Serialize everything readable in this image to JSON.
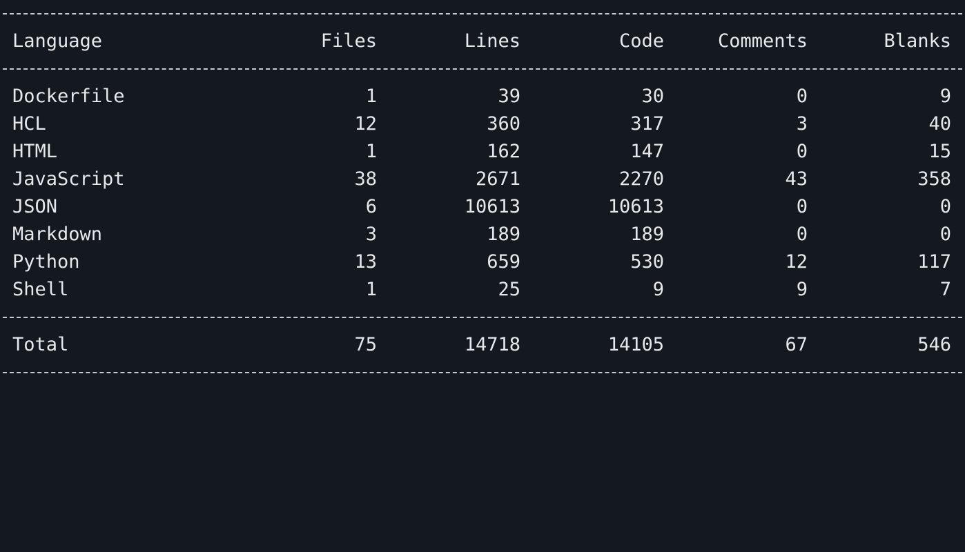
{
  "header": {
    "language": "Language",
    "files": "Files",
    "lines": "Lines",
    "code": "Code",
    "comments": "Comments",
    "blanks": "Blanks"
  },
  "rows": [
    {
      "language": "Dockerfile",
      "files": "1",
      "lines": "39",
      "code": "30",
      "comments": "0",
      "blanks": "9"
    },
    {
      "language": "HCL",
      "files": "12",
      "lines": "360",
      "code": "317",
      "comments": "3",
      "blanks": "40"
    },
    {
      "language": "HTML",
      "files": "1",
      "lines": "162",
      "code": "147",
      "comments": "0",
      "blanks": "15"
    },
    {
      "language": "JavaScript",
      "files": "38",
      "lines": "2671",
      "code": "2270",
      "comments": "43",
      "blanks": "358"
    },
    {
      "language": "JSON",
      "files": "6",
      "lines": "10613",
      "code": "10613",
      "comments": "0",
      "blanks": "0"
    },
    {
      "language": "Markdown",
      "files": "3",
      "lines": "189",
      "code": "189",
      "comments": "0",
      "blanks": "0"
    },
    {
      "language": "Python",
      "files": "13",
      "lines": "659",
      "code": "530",
      "comments": "12",
      "blanks": "117"
    },
    {
      "language": "Shell",
      "files": "1",
      "lines": "25",
      "code": "9",
      "comments": "9",
      "blanks": "7"
    }
  ],
  "total": {
    "language": "Total",
    "files": "75",
    "lines": "14718",
    "code": "14105",
    "comments": "67",
    "blanks": "546"
  }
}
